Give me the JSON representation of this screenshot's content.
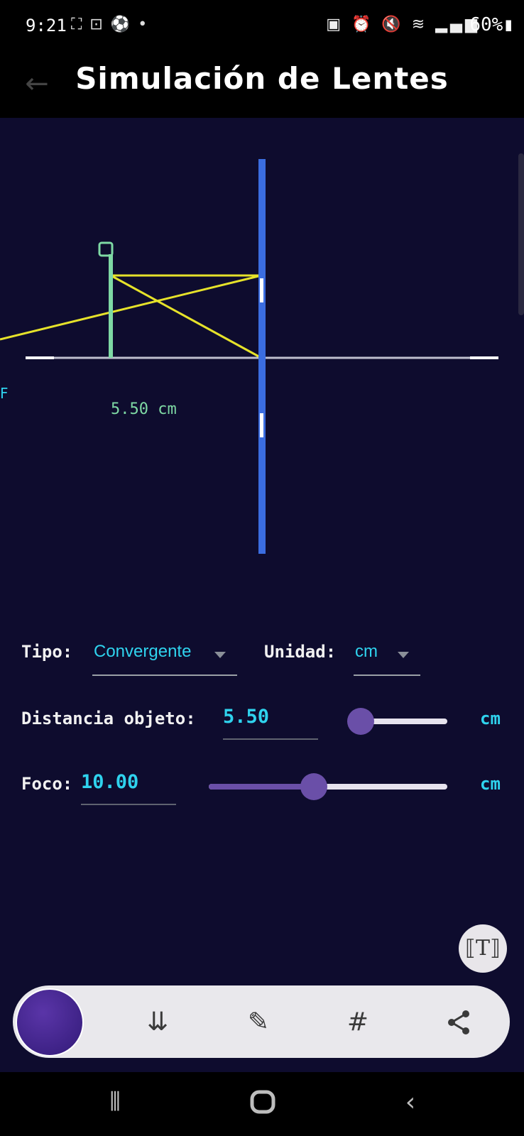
{
  "status_bar": {
    "time": "9:21",
    "battery": "60%",
    "icons_left": [
      "screenshot-icon",
      "screen-record-icon",
      "soccer-icon",
      "dot-icon"
    ],
    "icons_right": [
      "battery-saver-icon",
      "alarm-icon",
      "mute-icon",
      "wifi-icon",
      "volte-icon",
      "signal-icon"
    ]
  },
  "app_bar": {
    "title": "Simulación de Lentes",
    "back_icon": "back-arrow-icon"
  },
  "simulation": {
    "distance_label": "5.50 cm",
    "left_marker_label": "F",
    "colors": {
      "lens": "#3b6de0",
      "object": "#7ed9a4",
      "rays": "#e6e22a",
      "axis": "#bfbfcf",
      "marker": "#ffffff"
    }
  },
  "controls": {
    "tipo": {
      "label": "Tipo:",
      "value": "Convergente"
    },
    "unidad": {
      "label": "Unidad:",
      "value": "cm"
    },
    "distancia_objeto": {
      "label": "Distancia objeto:",
      "value": "5.50",
      "unit": "cm",
      "slider_fraction": 0.06
    },
    "foco": {
      "label": "Foco:",
      "value": "10.00",
      "unit": "cm",
      "slider_fraction": 0.44
    }
  },
  "screenshot_toolbar": {
    "text_button_icon": "text-scan-icon",
    "tools": [
      "scroll-capture-icon",
      "crop-edit-icon",
      "hashtag-icon",
      "share-icon"
    ]
  },
  "nav_bar": {
    "buttons": [
      "recent-apps-icon",
      "home-icon",
      "back-icon"
    ]
  }
}
